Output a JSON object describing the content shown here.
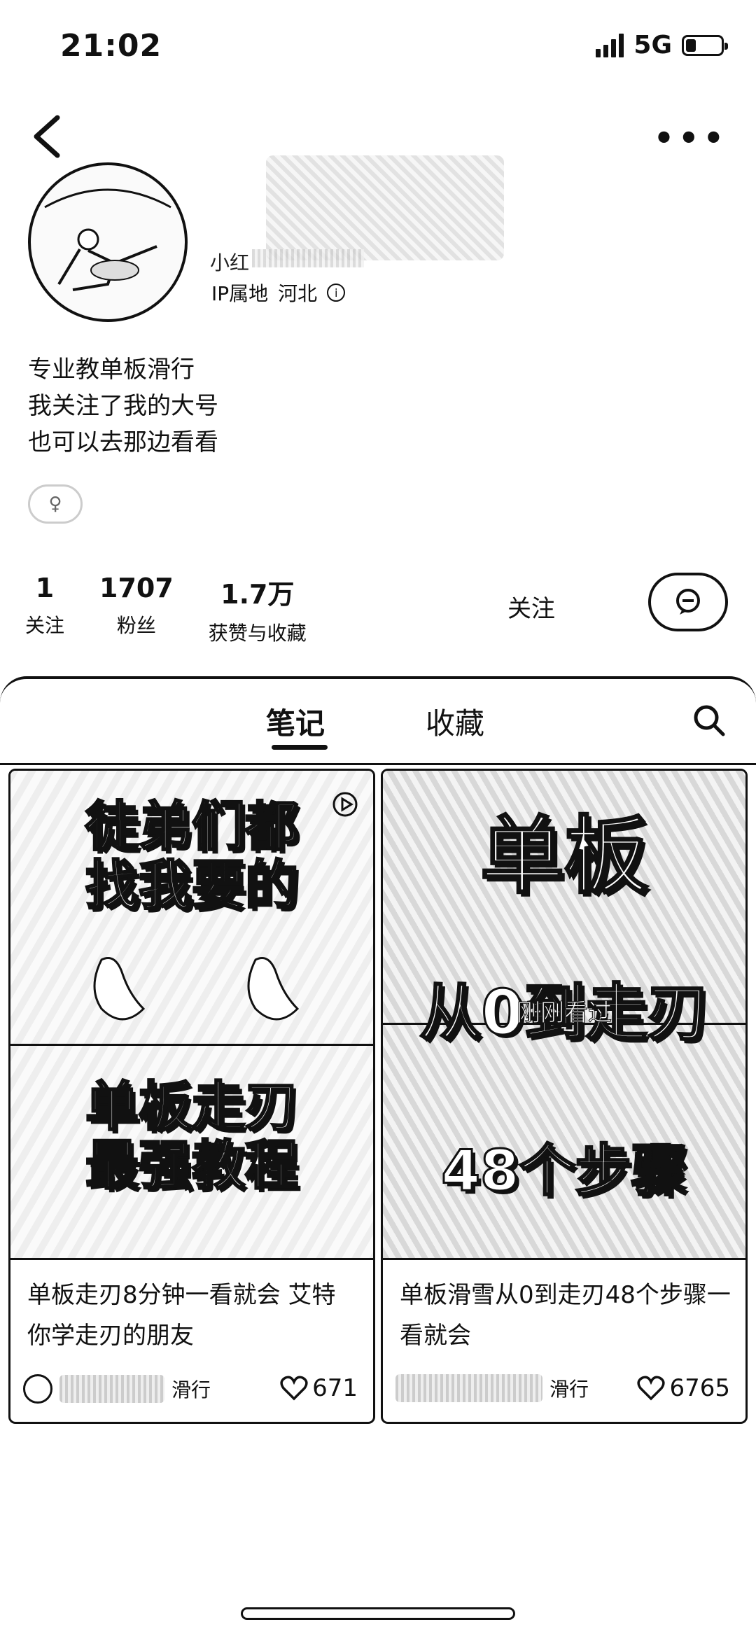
{
  "status": {
    "time": "21:02",
    "network": "5G"
  },
  "profile": {
    "nickname_visible": "小红",
    "ip_label": "IP属地",
    "ip_location": "河北",
    "bio": [
      "专业教单板滑行",
      "我关注了我的大号",
      "也可以去那边看看"
    ]
  },
  "stats": [
    {
      "value": "1",
      "label": "关注"
    },
    {
      "value": "1707",
      "label": "粉丝"
    },
    {
      "value": "1.7万",
      "label": "获赞与收藏"
    }
  ],
  "actions": {
    "follow": "关注"
  },
  "tabs": [
    {
      "label": "笔记",
      "active": true
    },
    {
      "label": "收藏",
      "active": false
    }
  ],
  "notes": [
    {
      "cover_top": [
        "徒弟们都",
        "找我要的"
      ],
      "cover_bottom": [
        "单板走刃",
        "最强教程"
      ],
      "title": "单板走刃8分钟一看就会 艾特你学走刃的朋友",
      "author_suffix": "滑行",
      "likes": "671"
    },
    {
      "cover_top": [
        "单板"
      ],
      "cover_mid": "从0到走刃",
      "seen": "刚刚看过",
      "cover_bottom": [
        "48个步骤"
      ],
      "title": "单板滑雪从0到走刃48个步骤一看就会",
      "author_suffix": "滑行",
      "likes": "6765"
    }
  ]
}
